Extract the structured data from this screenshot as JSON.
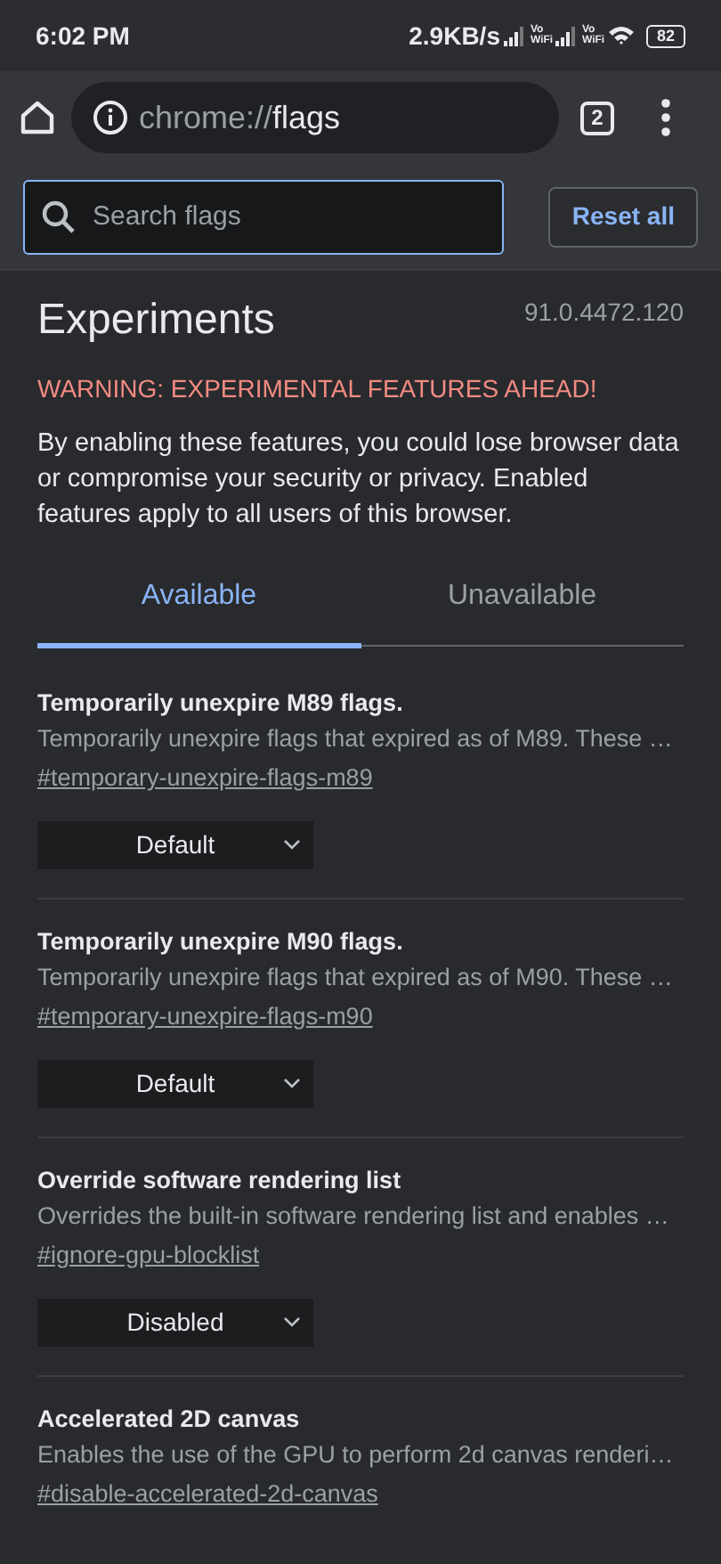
{
  "status_bar": {
    "time": "6:02 PM",
    "speed": "2.9KB/s",
    "sim_labels": [
      "Vo WiFi",
      "Vo WiFi"
    ],
    "battery": "82"
  },
  "toolbar": {
    "url_scheme": "chrome://",
    "url_path": "flags",
    "tab_count": "2"
  },
  "search": {
    "placeholder": "Search flags",
    "reset_label": "Reset all"
  },
  "header": {
    "title": "Experiments",
    "version": "91.0.4472.120",
    "warning": "WARNING: EXPERIMENTAL FEATURES AHEAD!",
    "description": "By enabling these features, you could lose browser data or compromise your security or privacy. Enabled features apply to all users of this browser."
  },
  "tabs": [
    {
      "label": "Available",
      "selected": true
    },
    {
      "label": "Unavailable",
      "selected": false
    }
  ],
  "flags": [
    {
      "title": "Temporarily unexpire M89 flags.",
      "description": "Temporarily unexpire flags that expired as of M89. These …",
      "link": "#temporary-unexpire-flags-m89",
      "value": "Default"
    },
    {
      "title": "Temporarily unexpire M90 flags.",
      "description": "Temporarily unexpire flags that expired as of M90. These …",
      "link": "#temporary-unexpire-flags-m90",
      "value": "Default"
    },
    {
      "title": "Override software rendering list",
      "description": "Overrides the built-in software rendering list and enables …",
      "link": "#ignore-gpu-blocklist",
      "value": "Disabled"
    },
    {
      "title": "Accelerated 2D canvas",
      "description": "Enables the use of the GPU to perform 2d canvas renderi…",
      "link": "#disable-accelerated-2d-canvas"
    }
  ]
}
